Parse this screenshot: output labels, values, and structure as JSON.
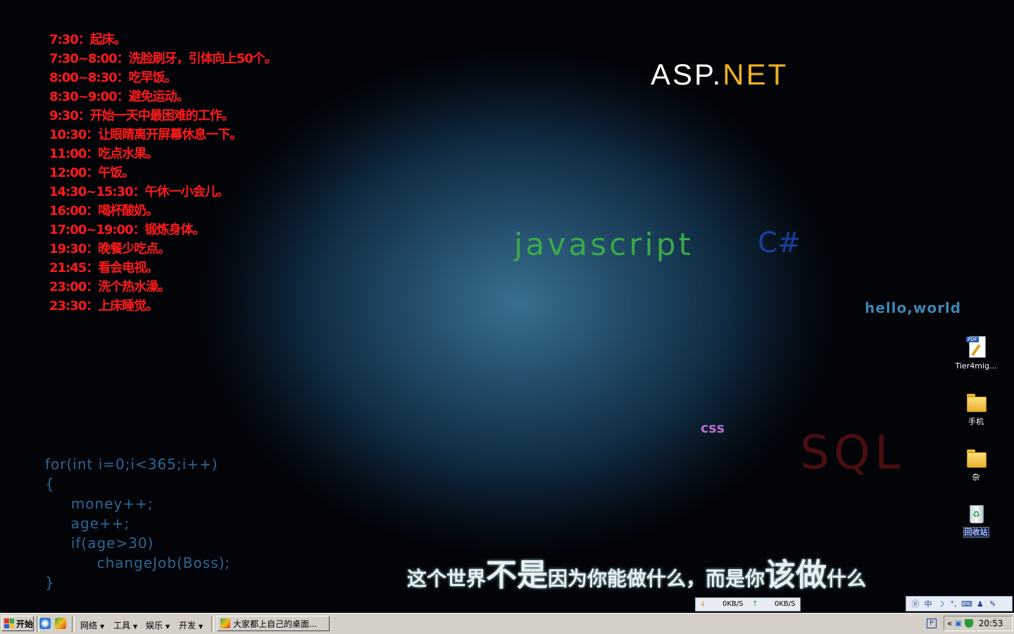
{
  "schedule": [
    "7:30：起床。",
    "7:30~8:00：洗脸刷牙，引体向上50个。",
    "8:00~8:30：吃早饭。",
    "8:30~9:00：避免运动。",
    "9:30：开始一天中最困难的工作。",
    "10:30：让眼睛离开屏幕休息一下。",
    "11:00：吃点水果。",
    "12:00：午饭。",
    "14:30~15:30：午休一小会儿。",
    "16:00：喝杯酸奶。",
    "17:00~19:00：锻炼身体。",
    "19:30：晚餐少吃点。",
    "21:45：看会电视。",
    "23:00：洗个热水澡。",
    "23:30：上床睡觉。"
  ],
  "wallpaper": {
    "asp_part1": "ASP.",
    "asp_part2": "NET",
    "javascript": "javascript",
    "csharp": "C#",
    "hello": "hello,world",
    "css": "css",
    "sql": "SQL",
    "code": "for(int i=0;i<365;i++)\n{\n     money++;\n     age++;\n     if(age>30)\n          changeJob(Boss);\n}",
    "slogan": [
      {
        "text": "这个世界",
        "size": "s"
      },
      {
        "text": "不是",
        "size": "l"
      },
      {
        "text": "因为你能做什么，而是你",
        "size": "s"
      },
      {
        "text": "该做",
        "size": "l"
      },
      {
        "text": "什么",
        "size": "s"
      }
    ]
  },
  "desktop_icons": [
    {
      "label": "Tier4mig...",
      "icon": "pdf-file-icon"
    },
    {
      "label": "手机",
      "icon": "folder-icon"
    },
    {
      "label": "杂",
      "icon": "folder-icon"
    },
    {
      "label": "回收站",
      "icon": "recycle-bin-icon"
    }
  ],
  "speed_meter": {
    "down_label": "0KB/S",
    "up_label": "0KB/S"
  },
  "language_bar": {
    "mode": "中"
  },
  "taskbar": {
    "start_label": "开始",
    "menus": [
      "网络",
      "工具",
      "娱乐",
      "开发"
    ],
    "task_label": "大家都上自己的桌面...",
    "clock": "20:53",
    "tray_expand": "«"
  },
  "colors": {
    "schedule": "#ff1a1a",
    "asp": "#ffffff",
    "net": "#f0b020",
    "javascript": "#3aa84a",
    "csharp": "#1a3f9a",
    "sql": "#4a0d10",
    "code": "#2d6793"
  }
}
